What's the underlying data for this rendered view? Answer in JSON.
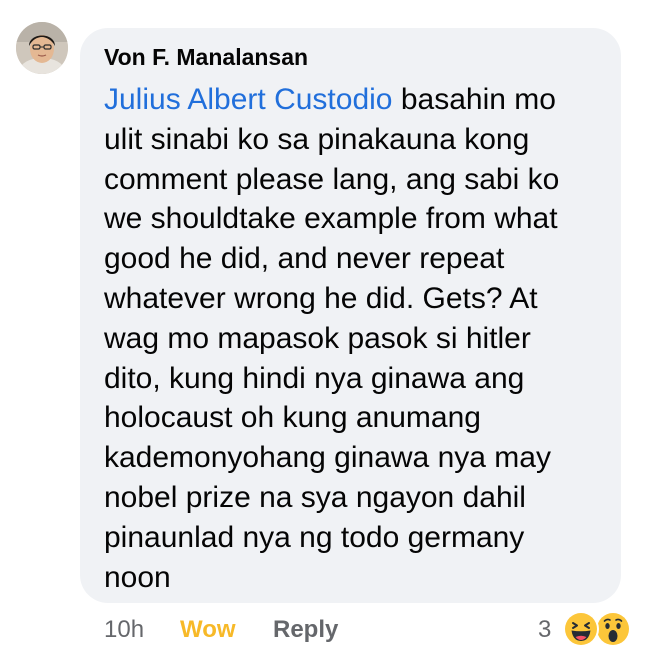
{
  "comment": {
    "author": "Von F. Manalansan",
    "mention": "Julius Albert Custodio",
    "body_lines": [
      " basahin mo",
      "ulit sinabi ko sa pinakauna kong",
      "comment please lang, ang sabi ko",
      "we shouldtake example from what",
      "good he did, and never repeat",
      "whatever wrong he did. Gets? At",
      "wag mo mapasok pasok si hitler",
      "dito, kung hindi nya ginawa ang",
      "holocaust oh kung anumang",
      "kademonyohang ginawa nya may",
      "nobel prize na sya ngayon dahil",
      "pinaunlad nya ng todo germany",
      "noon"
    ]
  },
  "actions": {
    "timestamp": "10h",
    "reaction_label": "Wow",
    "reply_label": "Reply"
  },
  "reactions": {
    "count": "3",
    "icons": [
      "haha-emoji-icon",
      "wow-emoji-icon"
    ]
  },
  "colors": {
    "bubble_bg": "#f0f2f5",
    "mention": "#216fdb",
    "wow_active": "#f7b928",
    "secondary_text": "#65676b"
  }
}
